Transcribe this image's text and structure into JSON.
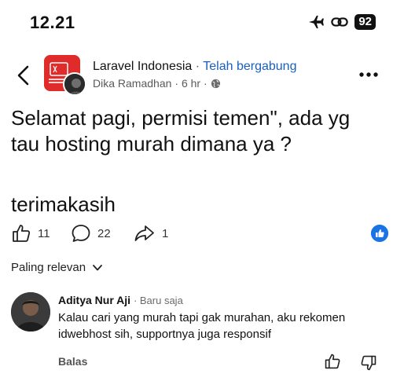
{
  "status_bar": {
    "time": "12.21",
    "battery": "92",
    "icons": [
      "airplane-icon",
      "link-icon",
      "battery-icon"
    ]
  },
  "header": {
    "group_name": "Laravel Indonesia",
    "separator": "·",
    "joined_label": "Telah bergabung",
    "author": "Dika Ramadhan",
    "time": "· 6 hr ·",
    "icons": [
      "back-icon",
      "globe-icon",
      "more-icon"
    ]
  },
  "post": {
    "text": "Selamat pagi, permisi temen\", ada yg tau hosting murah dimana ya ?",
    "thanks": "terimakasih"
  },
  "actions": {
    "likes": "11",
    "comments": "22",
    "shares": "1",
    "icons": [
      "like-icon",
      "comment-icon",
      "share-icon",
      "like-reaction-icon"
    ]
  },
  "sort": {
    "label": "Paling relevan"
  },
  "comment": {
    "author": "Aditya Nur Aji",
    "time": "· Baru saja",
    "body": "Kalau cari yang murah tapi gak murahan, aku rekomen idwebhost sih, supportnya juga responsif",
    "reply_label": "Balas"
  },
  "colors": {
    "accent_blue": "#1b74e4",
    "joined_blue": "#1a5fbf",
    "group_red": "#e02b2b"
  }
}
